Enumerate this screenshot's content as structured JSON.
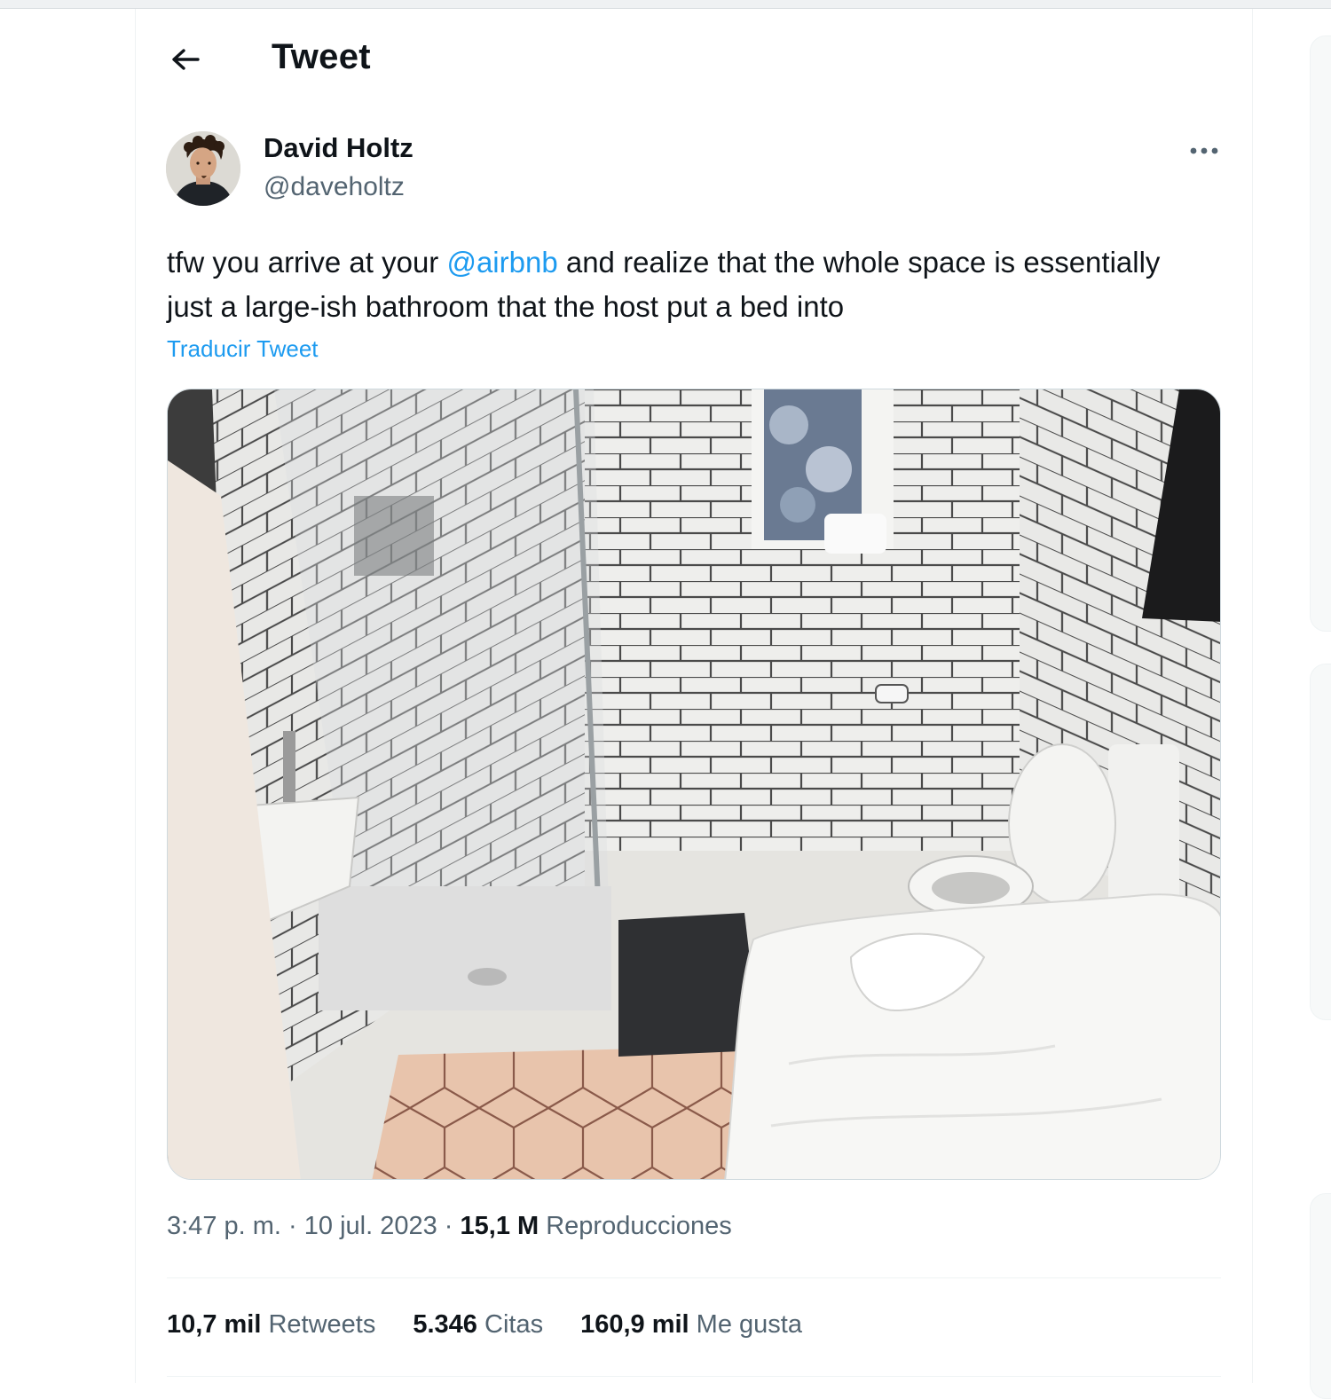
{
  "header": {
    "title": "Tweet",
    "back_icon": "arrow-left-icon"
  },
  "tweet": {
    "author": {
      "display_name": "David Holtz",
      "handle": "@daveholtz",
      "avatar": "avatar-photo"
    },
    "more_icon": "more-dots-icon",
    "text_before": "tfw you arrive at your ",
    "mention": "@airbnb",
    "text_after": " and realize that the whole space is essentially just a large-ish bathroom that the host put a bed into",
    "translate_label": "Traducir Tweet",
    "media": {
      "kind": "photo",
      "subject": "bathroom-with-bed"
    },
    "time": "3:47 p. m.",
    "sep": " · ",
    "date": "10 jul. 2023",
    "views_count": "15,1 M",
    "views_label": " Reproducciones"
  },
  "stats": [
    {
      "count": "10,7 mil",
      "label": " Retweets"
    },
    {
      "count": "5.346",
      "label": " Citas"
    },
    {
      "count": "160,9 mil",
      "label": " Me gusta"
    }
  ],
  "colors": {
    "accent": "#1d9bf0",
    "text": "#0f1419",
    "secondary": "#536471",
    "border": "#eff3f4"
  }
}
